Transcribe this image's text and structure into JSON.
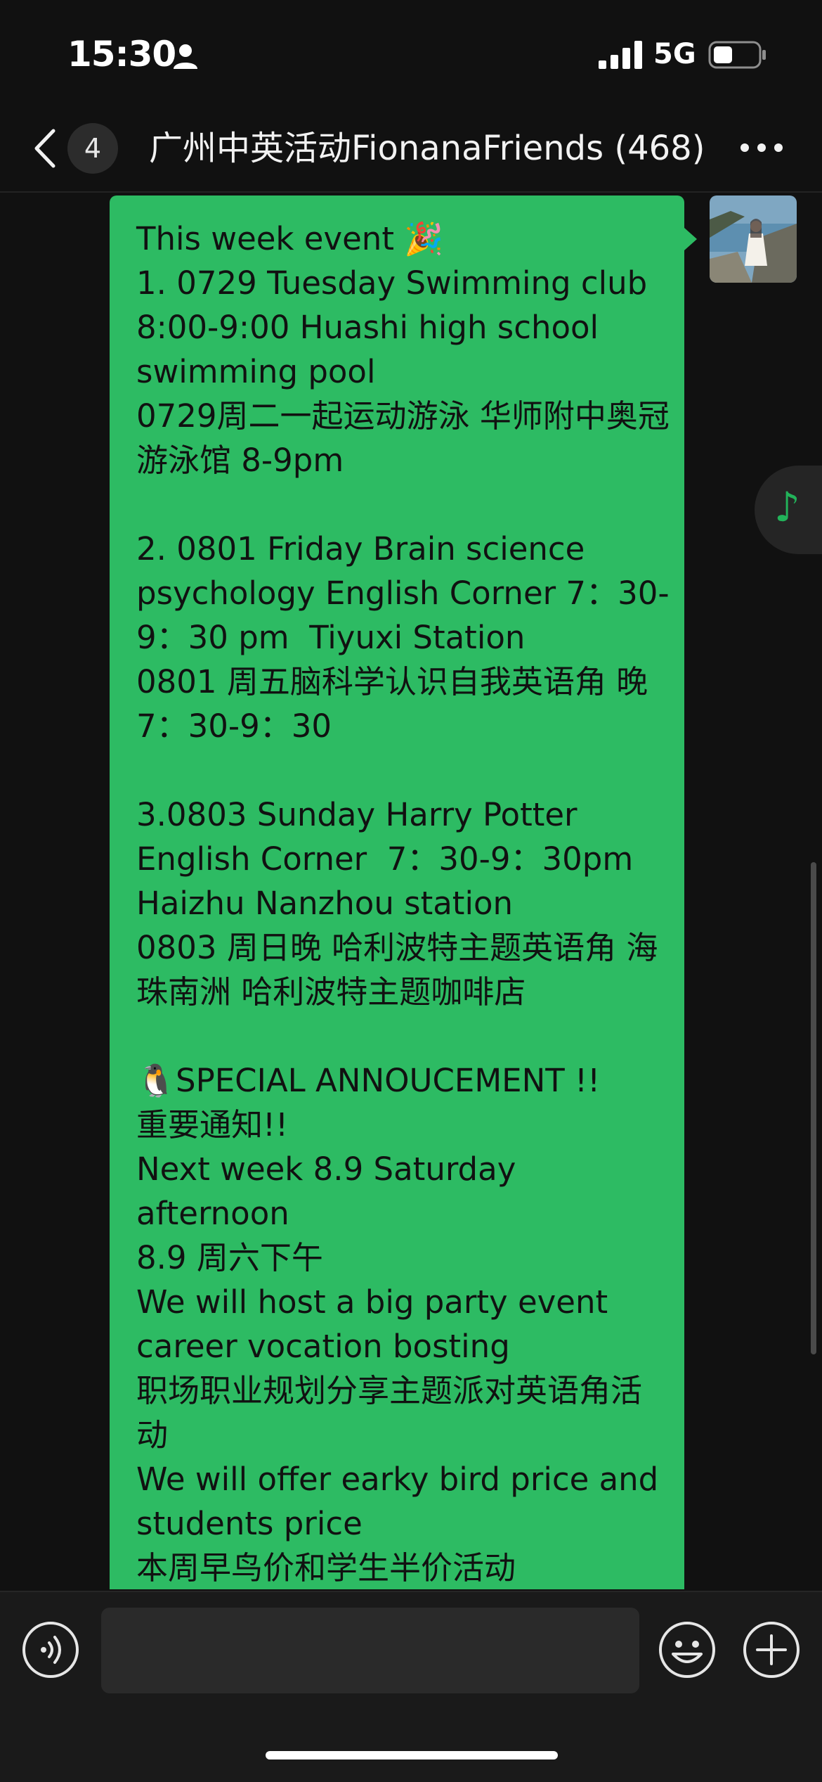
{
  "status_bar": {
    "time": "15:30",
    "network": "5G",
    "icons": [
      "person-icon",
      "signal-icon",
      "battery-icon"
    ]
  },
  "nav": {
    "back_icon": "chevron-left-icon",
    "unread_count": "4",
    "title": "广州中英活动FionanaFriends (468)",
    "more_icon": "more-dots-icon"
  },
  "message": {
    "sender_avatar": "avatar",
    "text": "This week event 🎉\n1. 0729 Tuesday Swimming club 8:00-9:00 Huashi high school swimming pool\n0729周二一起运动游泳 华师附中奥冠游泳馆 8-9pm\n\n2. 0801 Friday Brain science psychology English Corner 7：30-9：30 pm  Tiyuxi Station\n0801 周五脑科学认识自我英语角 晚7：30-9：30\n\n3.0803 Sunday Harry Potter English Corner  7：30-9：30pm Haizhu Nanzhou station\n0803 周日晚 哈利波特主题英语角 海珠南洲 哈利波特主题咖啡店\n\n🐧SPECIAL ANNOUCEMENT !!\n重要通知!!\nNext week 8.9 Saturday afternoon\n8.9 周六下午\nWe will host a big party event career vocation bosting\n职场职业规划分享主题派对英语角活动\nWe will offer earky bird price and students price\n本周早鸟价和学生半价活动"
  },
  "floating": {
    "music_icon": "music-note-icon",
    "music_glyph": "♪"
  },
  "input_bar": {
    "voice_icon": "voice-icon",
    "emoji_icon": "emoji-icon",
    "plus_icon": "plus-icon",
    "input_value": ""
  },
  "colors": {
    "background": "#111111",
    "bubble": "#2dbb63",
    "accent": "#22b35a"
  }
}
